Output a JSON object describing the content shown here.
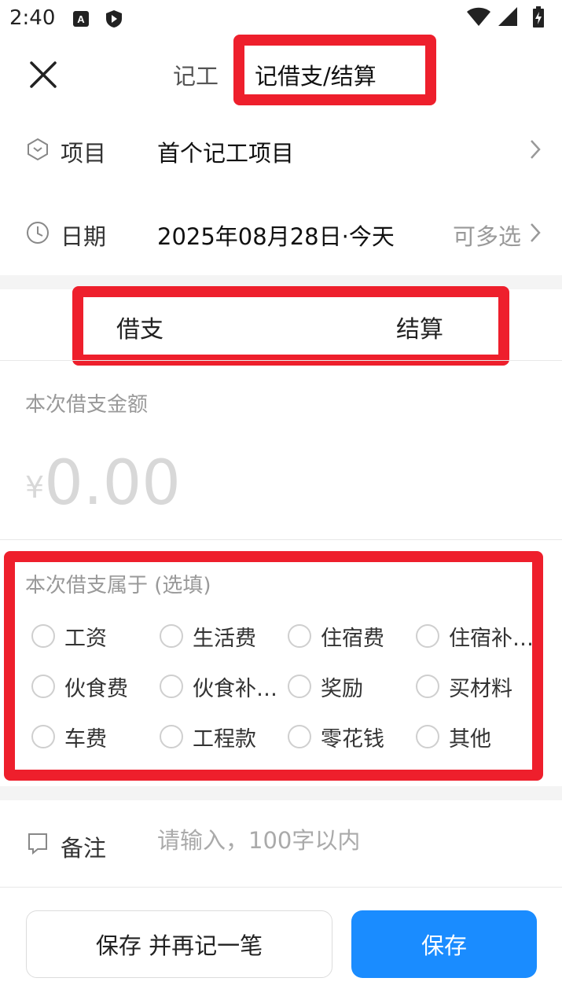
{
  "status_bar": {
    "time": "2:40",
    "icons": [
      "a-badge-icon",
      "play-protect-icon",
      "wifi-icon",
      "signal-icon",
      "battery-icon"
    ]
  },
  "header": {
    "close_icon": "close-icon",
    "tabs": [
      {
        "label": "记工"
      },
      {
        "label": "记借支/结算"
      }
    ]
  },
  "project_row": {
    "icon": "hexagon-icon",
    "label": "项目",
    "value": "首个记工项目"
  },
  "date_row": {
    "icon": "clock-icon",
    "label": "日期",
    "value": "2025年08月28日·今天",
    "hint": "可多选"
  },
  "segment": {
    "options": [
      {
        "label": "借支"
      },
      {
        "label": "结算"
      }
    ]
  },
  "amount": {
    "label": "本次借支金额",
    "currency": "¥",
    "value": "0.00"
  },
  "category": {
    "label": "本次借支属于 (选填)",
    "options": [
      {
        "label": "工资"
      },
      {
        "label": "生活费"
      },
      {
        "label": "住宿费"
      },
      {
        "label": "住宿补…"
      },
      {
        "label": "伙食费"
      },
      {
        "label": "伙食补…"
      },
      {
        "label": "奖励"
      },
      {
        "label": "买材料"
      },
      {
        "label": "车费"
      },
      {
        "label": "工程款"
      },
      {
        "label": "零花钱"
      },
      {
        "label": "其他"
      }
    ]
  },
  "note": {
    "icon": "note-icon",
    "label": "备注",
    "placeholder": "请输入，100字以内"
  },
  "footer": {
    "secondary_label": "保存 并再记一笔",
    "primary_label": "保存"
  },
  "colors": {
    "accent": "#1a8cff",
    "highlight": "#ee1f2c"
  }
}
